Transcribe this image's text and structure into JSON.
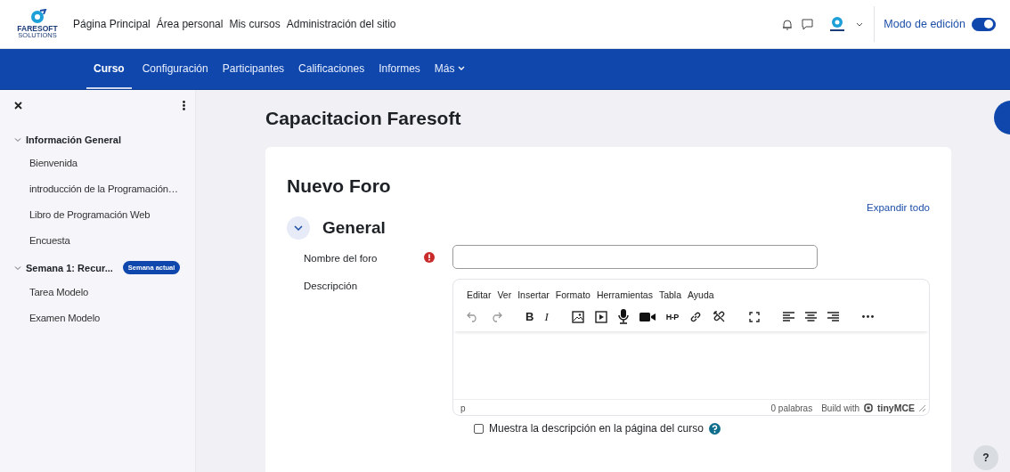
{
  "brand": {
    "name": "FARESOFT",
    "tagline": "SOLUTIONS"
  },
  "top_nav": [
    "Página Principal",
    "Área personal",
    "Mis cursos",
    "Administración del sitio"
  ],
  "edit_mode": {
    "label": "Modo de edición",
    "on": true
  },
  "course_tabs": [
    {
      "label": "Curso",
      "selected": true,
      "kind": "link"
    },
    {
      "label": "Configuración",
      "selected": false,
      "kind": "link"
    },
    {
      "label": "Participantes",
      "selected": false,
      "kind": "link"
    },
    {
      "label": "Calificaciones",
      "selected": false,
      "kind": "link"
    },
    {
      "label": "Informes",
      "selected": false,
      "kind": "link"
    },
    {
      "label": "Más",
      "selected": false,
      "kind": "dropdown"
    }
  ],
  "sidebar": {
    "sections": [
      {
        "title": "Información General",
        "expanded": true,
        "children": [
          "Bienvenida",
          "introducción de la Programación…",
          "Libro de Programación Web",
          "Encuesta"
        ]
      },
      {
        "title": "Semana 1: Recur...",
        "expanded": true,
        "badge": "Semana actual",
        "children": [
          "Tarea Modelo",
          "Examen Modelo"
        ]
      }
    ]
  },
  "course_title": "Capacitacion Faresoft",
  "form": {
    "title": "Nuevo Foro",
    "expand_all": "Expandir todo",
    "section": {
      "title": "General",
      "expanded": true
    },
    "name_field": {
      "label": "Nombre del foro",
      "required": true
    },
    "description": {
      "label": "Descripción"
    },
    "editor": {
      "menu": [
        "Editar",
        "Ver",
        "Insertar",
        "Formato",
        "Herramientas",
        "Tabla",
        "Ayuda"
      ],
      "bold": "B",
      "italic": "I",
      "h5p": "H-P",
      "path": "p",
      "word_count": "0 palabras",
      "credit": "Build with",
      "brand": "tinyMCE"
    },
    "show_description": {
      "label": "Muestra la descripción en la página del curso",
      "checked": false
    }
  },
  "help_button": "?"
}
